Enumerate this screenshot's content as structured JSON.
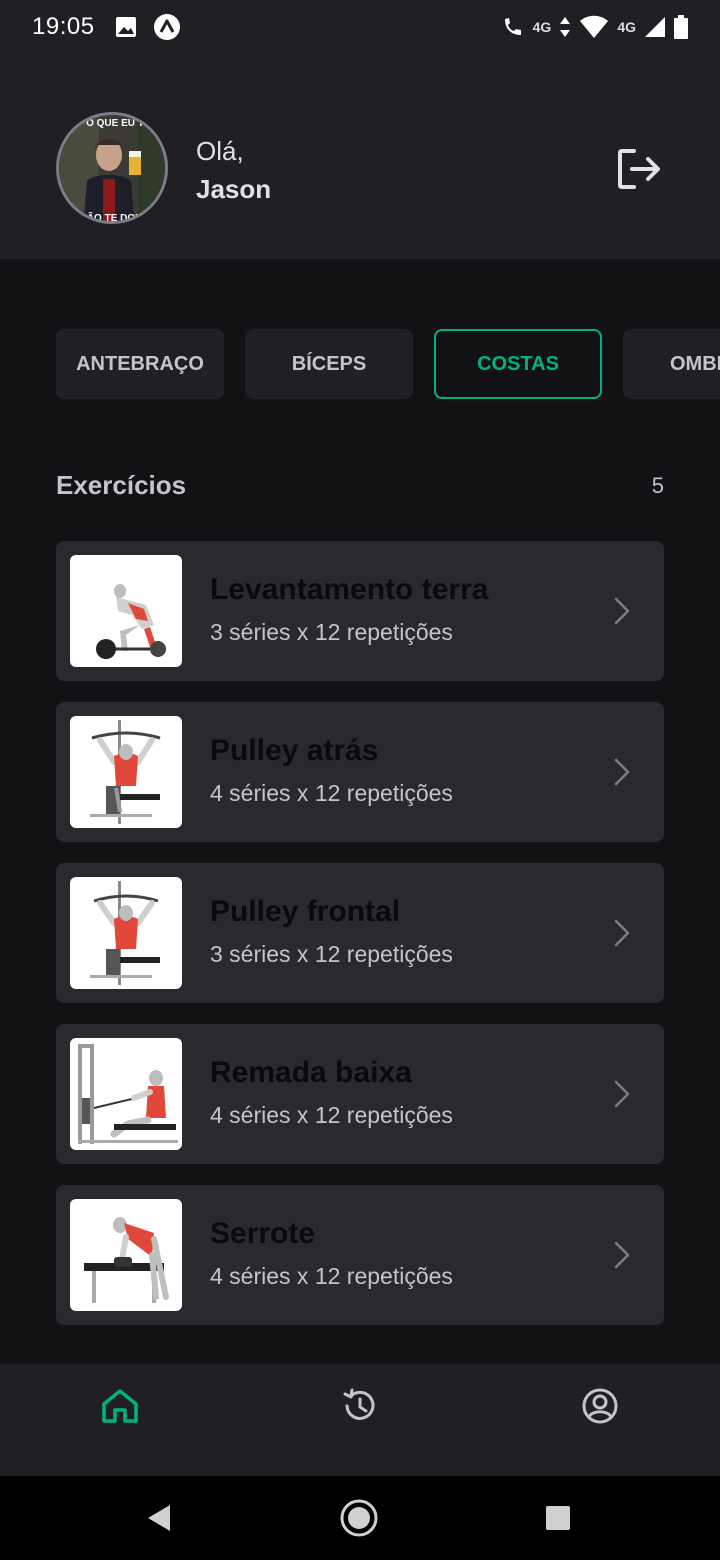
{
  "status_bar": {
    "time": "19:05",
    "network": "4G",
    "volte": "4G"
  },
  "header": {
    "greeting": "Olá,",
    "user_name": "Jason",
    "avatar_caption_top": "O QUE EU T",
    "avatar_caption_bottom": "NÃO TE DOU"
  },
  "groups": [
    "ANTEBRAÇO",
    "BÍCEPS",
    "COSTAS",
    "OMBRO"
  ],
  "active_group": "COSTAS",
  "exercises_section": {
    "title": "Exercícios",
    "count": "5"
  },
  "exercises": [
    {
      "name": "Levantamento terra",
      "meta": "3 séries x 12 repetições"
    },
    {
      "name": "Pulley atrás",
      "meta": "4 séries x 12 repetições"
    },
    {
      "name": "Pulley frontal",
      "meta": "3 séries x 12 repetições"
    },
    {
      "name": "Remada baixa",
      "meta": "4 séries x 12 repetições"
    },
    {
      "name": "Serrote",
      "meta": "4 séries x 12 repetições"
    }
  ],
  "tabs": [
    "home-icon",
    "history-icon",
    "profile-icon"
  ],
  "colors": {
    "accent": "#00B37E",
    "background": "#121214",
    "surface": "#202024",
    "card": "#29292E",
    "muscle": "#E0483B"
  }
}
